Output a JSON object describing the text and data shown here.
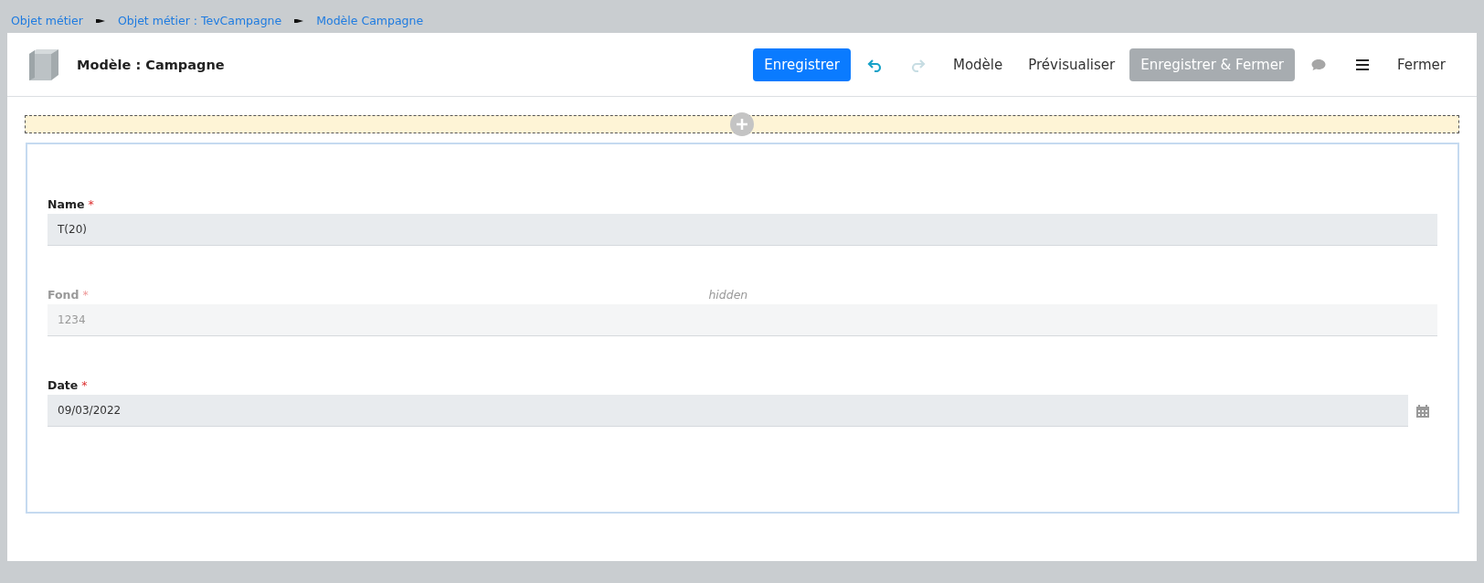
{
  "breadcrumbs": [
    {
      "label": "Objet métier"
    },
    {
      "label": "Objet métier : TevCampagne"
    },
    {
      "label": "Modèle Campagne"
    }
  ],
  "header": {
    "title": "Modèle : Campagne"
  },
  "toolbar": [
    {
      "kind": "primary",
      "label": "Enregistrer",
      "disabled": false
    },
    {
      "kind": "undo",
      "disabled": false
    },
    {
      "kind": "redo",
      "disabled": true
    },
    {
      "kind": "link",
      "label": "Modèle",
      "disabled": false
    },
    {
      "kind": "link",
      "label": "Prévisualiser",
      "disabled": false
    },
    {
      "kind": "primary",
      "label": "Enregistrer & Fermer",
      "disabled": true
    },
    {
      "kind": "comment",
      "disabled": false
    },
    {
      "kind": "menu",
      "disabled": false
    },
    {
      "kind": "link",
      "label": "Fermer",
      "disabled": false
    }
  ],
  "fields": [
    {
      "kind": "text",
      "label": "Name",
      "required_mark": "*",
      "value": "T(20)",
      "disabled": false
    },
    {
      "kind": "text",
      "label": "Fond",
      "required_mark": "*",
      "value": "1234",
      "disabled": true,
      "note": "hidden"
    },
    {
      "kind": "date",
      "label": "Date",
      "required_mark": "*",
      "value": "09/03/2022",
      "disabled": false
    }
  ]
}
